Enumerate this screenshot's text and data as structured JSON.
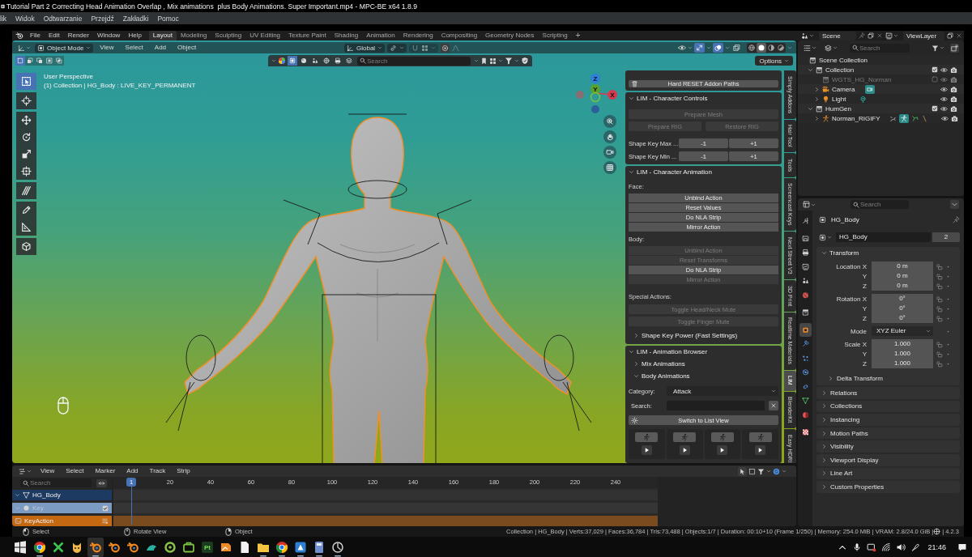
{
  "player": {
    "title": "Tutorial Part 2 Correcting Head Animation Overlap , Mix animations  plus Body Animations. Super Important.mp4 - MPC-BE x64 1.8.9",
    "menu": [
      "lik",
      "Widok",
      "Odtwarzanie",
      "Przejdź",
      "Zakładki",
      "Pomoc"
    ]
  },
  "topbar": {
    "menus": [
      "File",
      "Edit",
      "Render",
      "Window",
      "Help"
    ],
    "workspaces": [
      {
        "label": "Layout",
        "selected": true
      },
      {
        "label": "Modeling",
        "selected": false
      },
      {
        "label": "Sculpting",
        "selected": false
      },
      {
        "label": "UV Editing",
        "selected": false
      },
      {
        "label": "Texture Paint",
        "selected": false
      },
      {
        "label": "Shading",
        "selected": false
      },
      {
        "label": "Animation",
        "selected": false
      },
      {
        "label": "Rendering",
        "selected": false
      },
      {
        "label": "Compositing",
        "selected": false
      },
      {
        "label": "Geometry Nodes",
        "selected": false
      },
      {
        "label": "Scripting",
        "selected": false
      }
    ],
    "add_workspace": "+",
    "scene": "Scene",
    "view_layer": "ViewLayer"
  },
  "viewport": {
    "mode": "Object Mode",
    "menus": [
      "View",
      "Select",
      "Add",
      "Object"
    ],
    "orientation": "Global",
    "toggles": [
      {
        "kind": "gizmos",
        "on": true
      },
      {
        "kind": "overlays",
        "on": true
      },
      {
        "kind": "xray",
        "on": false
      }
    ],
    "shading": [
      {
        "kind": "wireframe",
        "selected": false
      },
      {
        "kind": "solid",
        "selected": true
      },
      {
        "kind": "material",
        "selected": false
      },
      {
        "kind": "rendered",
        "selected": false
      }
    ],
    "select_modes": [
      {
        "selected": true
      },
      {
        "selected": false
      },
      {
        "selected": false
      },
      {
        "selected": false
      },
      {
        "selected": false
      }
    ],
    "object_filters": [
      {
        "selected": true
      },
      {
        "selected": false
      },
      {
        "selected": false
      },
      {
        "selected": false
      },
      {
        "selected": false
      },
      {
        "selected": false
      }
    ],
    "search_placeholder": "Search",
    "options": "Options",
    "perspective": "User Perspective",
    "context": "(1) Collection | HG_Body : LIVE_KEY_PERMANENT",
    "gizmo_axes": [
      "Z",
      "Y",
      "X"
    ],
    "tools": [
      {
        "kind": "select",
        "selected": true
      },
      {
        "kind": "cursor",
        "selected": false
      },
      {
        "kind": "move",
        "selected": false
      },
      {
        "kind": "rotate",
        "selected": false
      },
      {
        "kind": "scale",
        "selected": false
      },
      {
        "kind": "transform",
        "selected": false
      },
      {
        "kind": "annotate",
        "selected": false
      },
      {
        "kind": "draw",
        "selected": false
      },
      {
        "kind": "measure",
        "selected": false
      },
      {
        "kind": "add_cube",
        "selected": false
      }
    ]
  },
  "sidebar": {
    "reset_button": "Hard RESET Addon Paths",
    "panels": [
      {
        "title": "LIM - Character Controls",
        "expanded": true,
        "rows": [
          {
            "kind": "buttons",
            "buttons": [
              {
                "label": "Prepare Mesh",
                "disabled": true
              }
            ]
          },
          {
            "kind": "buttons",
            "buttons": [
              {
                "label": "Prepare RIG",
                "disabled": true
              },
              {
                "label": "Restore RIG",
                "disabled": true
              }
            ]
          },
          {
            "kind": "labeled",
            "label": "Shape Key Max ...",
            "buttons": [
              {
                "label": "-1",
                "disabled": false
              },
              {
                "label": "+1",
                "disabled": false
              }
            ]
          },
          {
            "kind": "labeled",
            "label": "Shape Key Min ...",
            "buttons": [
              {
                "label": "-1",
                "disabled": false
              },
              {
                "label": "+1",
                "disabled": false
              }
            ]
          }
        ]
      },
      {
        "title": "LIM - Character Animation",
        "expanded": true,
        "rows": [
          {
            "kind": "heading",
            "label": "Face:"
          },
          {
            "kind": "stack",
            "buttons": [
              {
                "label": "Unbind Action",
                "disabled": false
              },
              {
                "label": "Reset Values",
                "disabled": false
              },
              {
                "label": "Do NLA Strip",
                "disabled": false
              },
              {
                "label": "Mirror Action",
                "disabled": false
              }
            ]
          },
          {
            "kind": "heading",
            "label": "Body:"
          },
          {
            "kind": "stack",
            "buttons": [
              {
                "label": "Unbind Action",
                "disabled": true
              },
              {
                "label": "Reset Transforms",
                "disabled": true
              },
              {
                "label": "Do NLA Strip",
                "disabled": false
              },
              {
                "label": "Mirror Action",
                "disabled": true
              }
            ]
          },
          {
            "kind": "heading",
            "label": "Special Actions:"
          },
          {
            "kind": "buttons",
            "buttons": [
              {
                "label": "Toggle Head/Neck Mute",
                "disabled": true
              }
            ]
          },
          {
            "kind": "buttons",
            "buttons": [
              {
                "label": "Toggle Finger Mute",
                "disabled": true
              }
            ]
          },
          {
            "kind": "subpanel",
            "label": "Shape Key Power (Fast Settings)",
            "expanded": false
          }
        ]
      },
      {
        "title": "LIM - Animation Browser",
        "expanded": true,
        "rows": [
          {
            "kind": "subpanel",
            "label": "Mix Animations",
            "expanded": false
          },
          {
            "kind": "subpanel",
            "label": "Body Animations",
            "expanded": true
          },
          {
            "kind": "dropdown",
            "label": "Category:",
            "value": "Attack"
          },
          {
            "kind": "search",
            "label": "Search:"
          },
          {
            "kind": "icon_button",
            "label": "Switch to List View"
          },
          {
            "kind": "thumbnails",
            "items": [
              {
                "kind": "animation"
              },
              {
                "kind": "animation"
              },
              {
                "kind": "animation"
              },
              {
                "kind": "animation"
              }
            ]
          }
        ]
      }
    ],
    "tabs": [
      {
        "label": "Simply Addons",
        "selected": false
      },
      {
        "label": "Hair Tool",
        "selected": false
      },
      {
        "label": "Tools",
        "selected": false
      },
      {
        "label": "Screencast Keys",
        "selected": false
      },
      {
        "label": "Next Street V3",
        "selected": false
      },
      {
        "label": "3D Print",
        "selected": false
      },
      {
        "label": "Realtime Materials",
        "selected": false
      },
      {
        "label": "LIM",
        "selected": true
      },
      {
        "label": "BlenderKit",
        "selected": false
      },
      {
        "label": "Easy HDRI",
        "selected": false
      }
    ]
  },
  "outliner": {
    "search_placeholder": "Search",
    "tree": [
      {
        "label": "Scene Collection",
        "kind": "scene",
        "disabled": false,
        "children": [
          {
            "label": "Collection",
            "kind": "collection",
            "expanded": true,
            "checked": true,
            "disabled": false,
            "children": [
              {
                "label": "WGTS_HG_Norman",
                "kind": "collection",
                "checked": false,
                "disabled": true
              },
              {
                "label": "Camera",
                "kind": "camera",
                "expanded": false,
                "disabled": false
              },
              {
                "label": "Light",
                "kind": "light",
                "expanded": false,
                "disabled": false
              }
            ]
          },
          {
            "label": "HumGen",
            "kind": "collection",
            "expanded": true,
            "checked": true,
            "disabled": false,
            "children": [
              {
                "label": "Norman_RIGIFY",
                "kind": "armature",
                "expanded": false,
                "disabled": false
              }
            ]
          }
        ]
      }
    ]
  },
  "properties": {
    "search_placeholder": "Search",
    "tabs": [
      {
        "kind": "tool",
        "selected": false
      },
      {
        "kind": "render",
        "selected": false
      },
      {
        "kind": "output",
        "selected": false
      },
      {
        "kind": "view_layer",
        "selected": false
      },
      {
        "kind": "scene",
        "selected": false
      },
      {
        "kind": "world",
        "selected": false
      },
      {
        "kind": "collection",
        "selected": false
      },
      {
        "kind": "object",
        "selected": true
      },
      {
        "kind": "modifiers",
        "selected": false
      },
      {
        "kind": "particles",
        "selected": false
      },
      {
        "kind": "physics",
        "selected": false
      },
      {
        "kind": "constraints",
        "selected": false
      },
      {
        "kind": "data",
        "selected": false
      },
      {
        "kind": "material",
        "selected": false
      },
      {
        "kind": "texture",
        "selected": false
      }
    ],
    "object_name": "HG_Body",
    "data_name": "HG_Body",
    "users": "2",
    "transform": {
      "title": "Transform",
      "expanded": true,
      "groups": [
        [
          {
            "label": "Location X",
            "value": "0 m",
            "kind": "number"
          },
          {
            "label": "Y",
            "value": "0 m",
            "kind": "number"
          },
          {
            "label": "Z",
            "value": "0 m",
            "kind": "number"
          }
        ],
        [
          {
            "label": "Rotation X",
            "value": "0°",
            "kind": "number"
          },
          {
            "label": "Y",
            "value": "0°",
            "kind": "number"
          },
          {
            "label": "Z",
            "value": "0°",
            "kind": "number"
          }
        ],
        [
          {
            "label": "Mode",
            "value": "XYZ Euler",
            "kind": "dropdown"
          }
        ],
        [
          {
            "label": "Scale X",
            "value": "1.000",
            "kind": "number"
          },
          {
            "label": "Y",
            "value": "1.000",
            "kind": "number"
          },
          {
            "label": "Z",
            "value": "1.000",
            "kind": "number"
          }
        ]
      ],
      "subpanels": [
        {
          "label": "Delta Transform",
          "expanded": false
        }
      ]
    },
    "sections": [
      {
        "label": "Relations",
        "expanded": false
      },
      {
        "label": "Collections",
        "expanded": false
      },
      {
        "label": "Instancing",
        "expanded": false
      },
      {
        "label": "Motion Paths",
        "expanded": false
      },
      {
        "label": "Visibility",
        "expanded": false
      },
      {
        "label": "Viewport Display",
        "expanded": false
      },
      {
        "label": "Line Art",
        "expanded": false
      },
      {
        "label": "Custom Properties",
        "expanded": false
      }
    ]
  },
  "timeline": {
    "menus": [
      "View",
      "Select",
      "Marker",
      "Add",
      "Track",
      "Strip"
    ],
    "search_placeholder": "Search",
    "current_frame": "1",
    "ticks": [
      "20",
      "40",
      "60",
      "80",
      "100",
      "120",
      "140",
      "160",
      "180",
      "200",
      "220",
      "240"
    ],
    "channels": [
      {
        "label": "HG_Body",
        "kind": "object",
        "disabled": false
      },
      {
        "label": "Key",
        "kind": "shape_keys",
        "disabled": true,
        "checked": true
      },
      {
        "label": "KeyAction",
        "kind": "action",
        "disabled": false
      }
    ]
  },
  "status_bar": {
    "hints": [
      {
        "label": "Select",
        "kind": "left_click"
      },
      {
        "label": "Rotate View",
        "kind": "middle_click"
      },
      {
        "label": "Object",
        "kind": "right_click"
      }
    ],
    "stats": "Collection | HG_Body | Verts:37,029 | Faces:36,784 | Tris:73,488 | Objects:1/7 | Duration: 00:10+10 (Frame 1/250) | Memory: 254.0 MiB | VRAM: 2.8/24.0 GiB |",
    "version": "| 4.2.3"
  },
  "taskbar": {
    "apps": [
      {
        "kind": "color_circle",
        "running": true,
        "selected": false
      },
      {
        "kind": "cross_logo",
        "running": false,
        "selected": false
      },
      {
        "kind": "cat",
        "running": false,
        "selected": false
      },
      {
        "kind": "ring_logo",
        "running": true,
        "selected": true
      },
      {
        "kind": "ring_logo",
        "running": false,
        "selected": false
      },
      {
        "kind": "ring_logo",
        "running": false,
        "selected": false
      },
      {
        "kind": "shell",
        "running": false,
        "selected": false
      },
      {
        "kind": "ring",
        "running": false,
        "selected": false
      },
      {
        "kind": "briefcase",
        "running": false,
        "selected": false
      },
      {
        "kind": "letter_tile",
        "label": "Pt",
        "running": false,
        "selected": false
      },
      {
        "kind": "image_tile",
        "running": false,
        "selected": false
      },
      {
        "kind": "document",
        "running": false,
        "selected": false
      },
      {
        "kind": "folder",
        "running": true,
        "selected": false
      },
      {
        "kind": "color_circle",
        "running": true,
        "selected": false
      },
      {
        "kind": "triangle_tile",
        "running": true,
        "selected": false
      },
      {
        "kind": "calculator",
        "running": true,
        "selected": false
      },
      {
        "kind": "dial",
        "running": true,
        "selected": false
      }
    ],
    "clock": "21:46"
  }
}
